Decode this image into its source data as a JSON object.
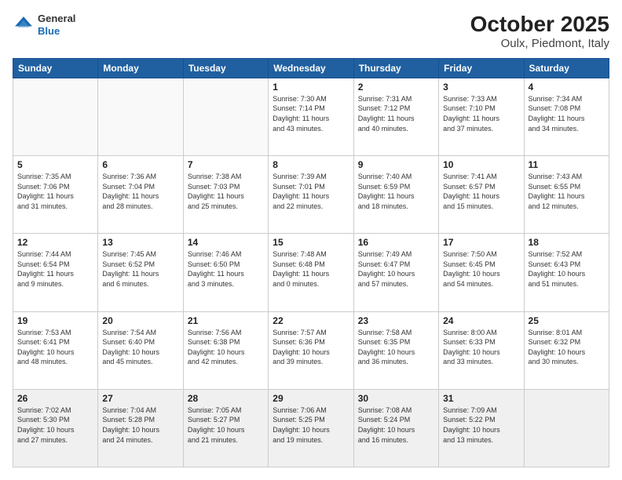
{
  "header": {
    "logo_general": "General",
    "logo_blue": "Blue",
    "title": "October 2025",
    "subtitle": "Oulx, Piedmont, Italy"
  },
  "calendar": {
    "days_of_week": [
      "Sunday",
      "Monday",
      "Tuesday",
      "Wednesday",
      "Thursday",
      "Friday",
      "Saturday"
    ],
    "weeks": [
      [
        {
          "day": "",
          "info": ""
        },
        {
          "day": "",
          "info": ""
        },
        {
          "day": "",
          "info": ""
        },
        {
          "day": "1",
          "info": "Sunrise: 7:30 AM\nSunset: 7:14 PM\nDaylight: 11 hours\nand 43 minutes."
        },
        {
          "day": "2",
          "info": "Sunrise: 7:31 AM\nSunset: 7:12 PM\nDaylight: 11 hours\nand 40 minutes."
        },
        {
          "day": "3",
          "info": "Sunrise: 7:33 AM\nSunset: 7:10 PM\nDaylight: 11 hours\nand 37 minutes."
        },
        {
          "day": "4",
          "info": "Sunrise: 7:34 AM\nSunset: 7:08 PM\nDaylight: 11 hours\nand 34 minutes."
        }
      ],
      [
        {
          "day": "5",
          "info": "Sunrise: 7:35 AM\nSunset: 7:06 PM\nDaylight: 11 hours\nand 31 minutes."
        },
        {
          "day": "6",
          "info": "Sunrise: 7:36 AM\nSunset: 7:04 PM\nDaylight: 11 hours\nand 28 minutes."
        },
        {
          "day": "7",
          "info": "Sunrise: 7:38 AM\nSunset: 7:03 PM\nDaylight: 11 hours\nand 25 minutes."
        },
        {
          "day": "8",
          "info": "Sunrise: 7:39 AM\nSunset: 7:01 PM\nDaylight: 11 hours\nand 22 minutes."
        },
        {
          "day": "9",
          "info": "Sunrise: 7:40 AM\nSunset: 6:59 PM\nDaylight: 11 hours\nand 18 minutes."
        },
        {
          "day": "10",
          "info": "Sunrise: 7:41 AM\nSunset: 6:57 PM\nDaylight: 11 hours\nand 15 minutes."
        },
        {
          "day": "11",
          "info": "Sunrise: 7:43 AM\nSunset: 6:55 PM\nDaylight: 11 hours\nand 12 minutes."
        }
      ],
      [
        {
          "day": "12",
          "info": "Sunrise: 7:44 AM\nSunset: 6:54 PM\nDaylight: 11 hours\nand 9 minutes."
        },
        {
          "day": "13",
          "info": "Sunrise: 7:45 AM\nSunset: 6:52 PM\nDaylight: 11 hours\nand 6 minutes."
        },
        {
          "day": "14",
          "info": "Sunrise: 7:46 AM\nSunset: 6:50 PM\nDaylight: 11 hours\nand 3 minutes."
        },
        {
          "day": "15",
          "info": "Sunrise: 7:48 AM\nSunset: 6:48 PM\nDaylight: 11 hours\nand 0 minutes."
        },
        {
          "day": "16",
          "info": "Sunrise: 7:49 AM\nSunset: 6:47 PM\nDaylight: 10 hours\nand 57 minutes."
        },
        {
          "day": "17",
          "info": "Sunrise: 7:50 AM\nSunset: 6:45 PM\nDaylight: 10 hours\nand 54 minutes."
        },
        {
          "day": "18",
          "info": "Sunrise: 7:52 AM\nSunset: 6:43 PM\nDaylight: 10 hours\nand 51 minutes."
        }
      ],
      [
        {
          "day": "19",
          "info": "Sunrise: 7:53 AM\nSunset: 6:41 PM\nDaylight: 10 hours\nand 48 minutes."
        },
        {
          "day": "20",
          "info": "Sunrise: 7:54 AM\nSunset: 6:40 PM\nDaylight: 10 hours\nand 45 minutes."
        },
        {
          "day": "21",
          "info": "Sunrise: 7:56 AM\nSunset: 6:38 PM\nDaylight: 10 hours\nand 42 minutes."
        },
        {
          "day": "22",
          "info": "Sunrise: 7:57 AM\nSunset: 6:36 PM\nDaylight: 10 hours\nand 39 minutes."
        },
        {
          "day": "23",
          "info": "Sunrise: 7:58 AM\nSunset: 6:35 PM\nDaylight: 10 hours\nand 36 minutes."
        },
        {
          "day": "24",
          "info": "Sunrise: 8:00 AM\nSunset: 6:33 PM\nDaylight: 10 hours\nand 33 minutes."
        },
        {
          "day": "25",
          "info": "Sunrise: 8:01 AM\nSunset: 6:32 PM\nDaylight: 10 hours\nand 30 minutes."
        }
      ],
      [
        {
          "day": "26",
          "info": "Sunrise: 7:02 AM\nSunset: 5:30 PM\nDaylight: 10 hours\nand 27 minutes."
        },
        {
          "day": "27",
          "info": "Sunrise: 7:04 AM\nSunset: 5:28 PM\nDaylight: 10 hours\nand 24 minutes."
        },
        {
          "day": "28",
          "info": "Sunrise: 7:05 AM\nSunset: 5:27 PM\nDaylight: 10 hours\nand 21 minutes."
        },
        {
          "day": "29",
          "info": "Sunrise: 7:06 AM\nSunset: 5:25 PM\nDaylight: 10 hours\nand 19 minutes."
        },
        {
          "day": "30",
          "info": "Sunrise: 7:08 AM\nSunset: 5:24 PM\nDaylight: 10 hours\nand 16 minutes."
        },
        {
          "day": "31",
          "info": "Sunrise: 7:09 AM\nSunset: 5:22 PM\nDaylight: 10 hours\nand 13 minutes."
        },
        {
          "day": "",
          "info": ""
        }
      ]
    ]
  }
}
